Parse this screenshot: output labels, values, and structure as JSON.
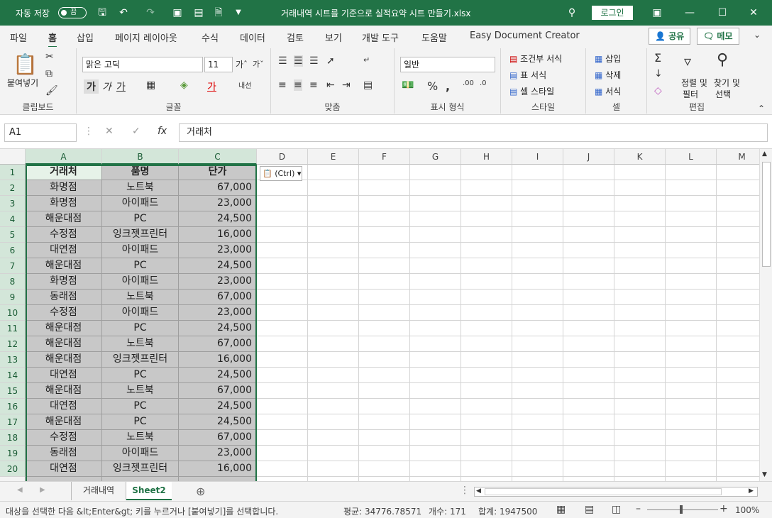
{
  "titlebar": {
    "autosave_label": "자동 저장",
    "autosave_state": "끔",
    "filename": "거래내역 시트를 기준으로 실적요약 시트 만들기.xlsx",
    "login": "로그인"
  },
  "menu": {
    "items": [
      "파일",
      "홈",
      "삽입",
      "페이지 레이아웃",
      "수식",
      "데이터",
      "검토",
      "보기",
      "개발 도구",
      "도움말",
      "Easy Document Creator"
    ],
    "active": "홈",
    "share": "공유",
    "memo": "메모"
  },
  "ribbon": {
    "clipboard": {
      "paste": "붙여넣기",
      "label": "클립보드"
    },
    "font": {
      "name": "맑은 고딕",
      "size": "11",
      "bold": "가",
      "italic": "가",
      "underline": "가",
      "color_btn": "가",
      "label": "글꼴"
    },
    "align": {
      "label": "맞춤"
    },
    "number": {
      "format": "일반",
      "label": "표시 형식"
    },
    "styles": {
      "cond": "조건부 서식",
      "table": "표 서식",
      "cell": "셀 스타일",
      "label": "스타일"
    },
    "cells": {
      "insert": "삽입",
      "delete": "삭제",
      "format": "서식",
      "label": "셀"
    },
    "edit": {
      "sort1": "정렬 및",
      "sort2": "필터",
      "find1": "찾기 및",
      "find2": "선택",
      "label": "편집"
    }
  },
  "formula_bar": {
    "namebox": "A1",
    "content": "거래처"
  },
  "columns": [
    "A",
    "B",
    "C",
    "D",
    "E",
    "F",
    "G",
    "H",
    "I",
    "J",
    "K",
    "L",
    "M"
  ],
  "headers": [
    "거래처",
    "품명",
    "단가"
  ],
  "rows": [
    [
      "화명점",
      "노트북",
      "67,000"
    ],
    [
      "화명점",
      "아이패드",
      "23,000"
    ],
    [
      "해운대점",
      "PC",
      "24,500"
    ],
    [
      "수정점",
      "잉크젯프린터",
      "16,000"
    ],
    [
      "대연점",
      "아이패드",
      "23,000"
    ],
    [
      "해운대점",
      "PC",
      "24,500"
    ],
    [
      "화명점",
      "아이패드",
      "23,000"
    ],
    [
      "동래점",
      "노트북",
      "67,000"
    ],
    [
      "수정점",
      "아이패드",
      "23,000"
    ],
    [
      "해운대점",
      "PC",
      "24,500"
    ],
    [
      "해운대점",
      "노트북",
      "67,000"
    ],
    [
      "해운대점",
      "잉크젯프린터",
      "16,000"
    ],
    [
      "대연점",
      "PC",
      "24,500"
    ],
    [
      "해운대점",
      "노트북",
      "67,000"
    ],
    [
      "대연점",
      "PC",
      "24,500"
    ],
    [
      "해운대점",
      "PC",
      "24,500"
    ],
    [
      "수정점",
      "노트북",
      "67,000"
    ],
    [
      "동래점",
      "아이패드",
      "23,000"
    ],
    [
      "대연점",
      "잉크젯프린터",
      "16,000"
    ]
  ],
  "row_numbers": [
    "1",
    "2",
    "3",
    "4",
    "5",
    "6",
    "7",
    "8",
    "9",
    "10",
    "11",
    "12",
    "13",
    "14",
    "15",
    "16",
    "17",
    "18",
    "19",
    "20"
  ],
  "paste_options": "(Ctrl)",
  "sheets": [
    "거래내역",
    "Sheet2"
  ],
  "active_sheet": "Sheet2",
  "status": {
    "message": "대상을 선택한 다음 &lt;Enter&gt; 키를 누르거나 [붙여넣기]를 선택합니다.",
    "average": "평균: 34776.78571",
    "count": "개수: 171",
    "sum": "합계: 1947500",
    "zoom": "100%"
  },
  "colors": {
    "accent": "#217346",
    "selection": "#c8c8c8"
  }
}
